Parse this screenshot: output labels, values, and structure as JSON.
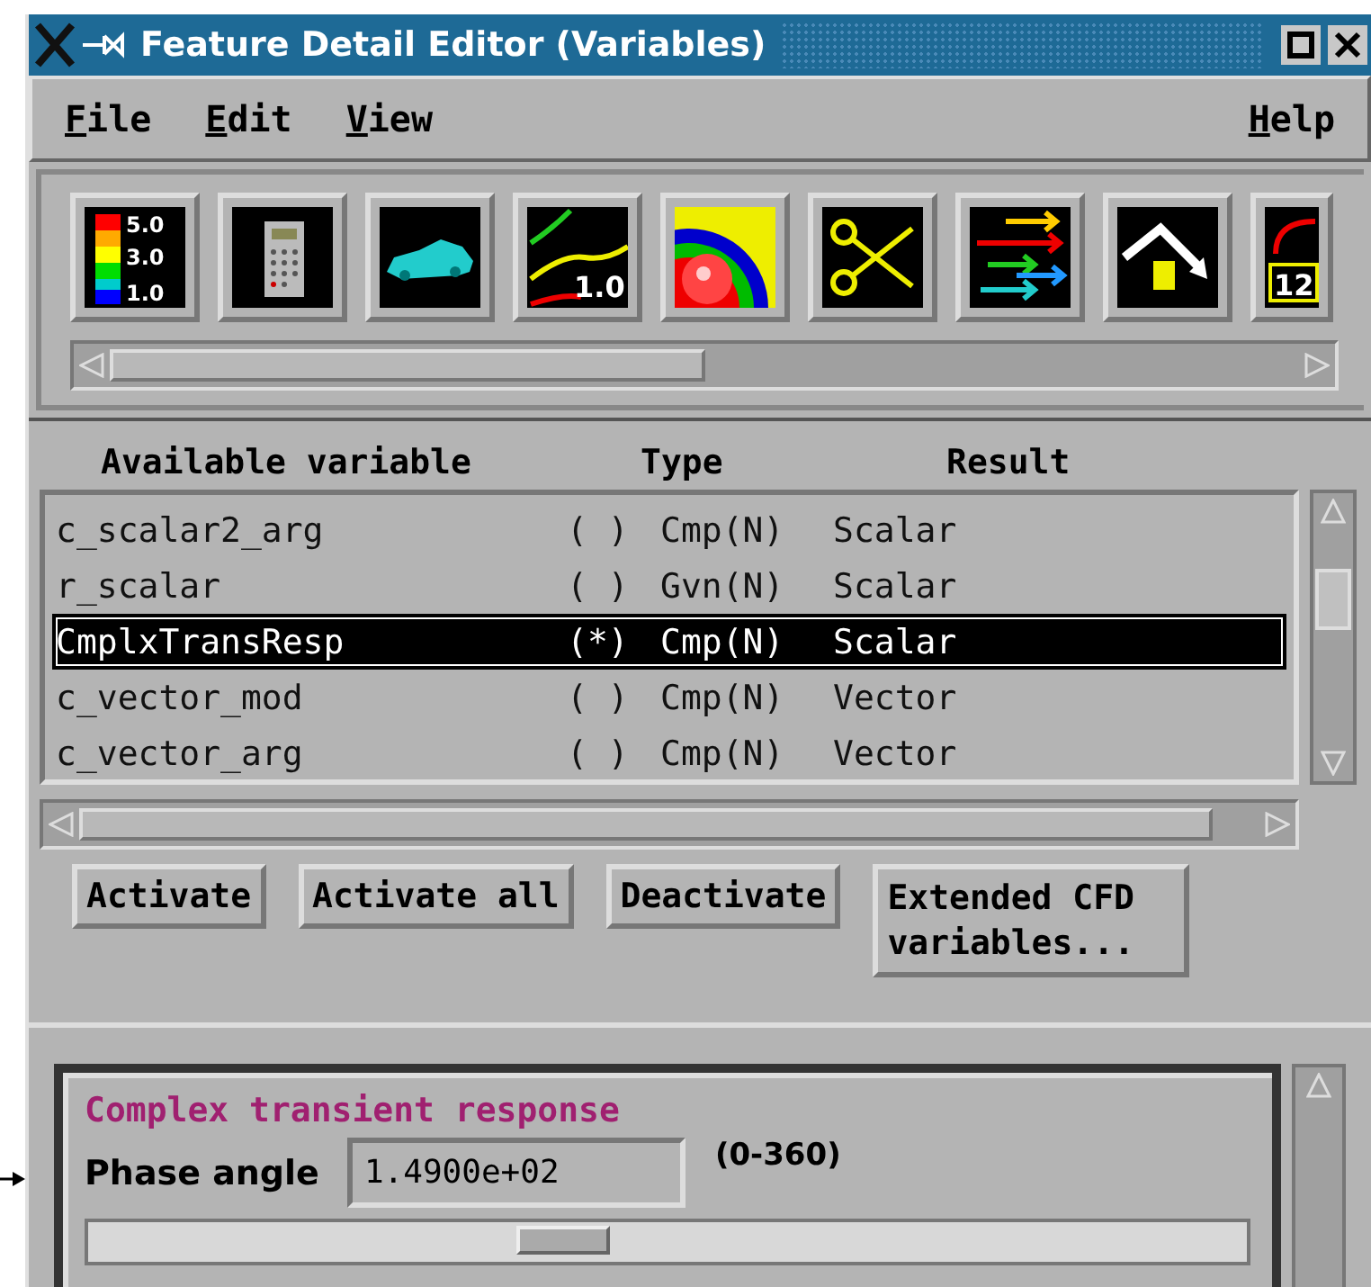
{
  "window": {
    "title": "Feature Detail Editor (Variables)"
  },
  "menu": {
    "left": [
      "File",
      "Edit",
      "View"
    ],
    "right": [
      "Help"
    ]
  },
  "toolbar": {
    "tools": [
      {
        "kind": "legend",
        "labels": [
          "5.0",
          "3.0",
          "1.0"
        ]
      },
      {
        "kind": "calculator"
      },
      {
        "kind": "car"
      },
      {
        "kind": "contour",
        "label": "1.0"
      },
      {
        "kind": "target"
      },
      {
        "kind": "scissors"
      },
      {
        "kind": "arrows"
      },
      {
        "kind": "arch"
      },
      {
        "kind": "partial",
        "label": "12"
      }
    ]
  },
  "variables": {
    "columns": [
      "Available variable",
      "Type",
      "Result"
    ],
    "rows": [
      {
        "name": "c_scalar2_arg",
        "marker": "( )",
        "type": "Cmp(N)",
        "result": "Scalar",
        "selected": false
      },
      {
        "name": "r_scalar",
        "marker": "( )",
        "type": "Gvn(N)",
        "result": "Scalar",
        "selected": false
      },
      {
        "name": "CmplxTransResp",
        "marker": "(*)",
        "type": "Cmp(N)",
        "result": "Scalar",
        "selected": true
      },
      {
        "name": "c_vector_mod",
        "marker": "( )",
        "type": "Cmp(N)",
        "result": "Vector",
        "selected": false
      },
      {
        "name": "c_vector_arg",
        "marker": "( )",
        "type": "Cmp(N)",
        "result": "Vector",
        "selected": false
      }
    ]
  },
  "buttons": [
    "Activate",
    "Activate all",
    "Deactivate",
    "Extended CFD variables..."
  ],
  "detail": {
    "heading": "Complex transient response",
    "field_label": "Phase angle",
    "value": "1.4900e+02",
    "range": "(0-360)",
    "level": 0.41
  }
}
